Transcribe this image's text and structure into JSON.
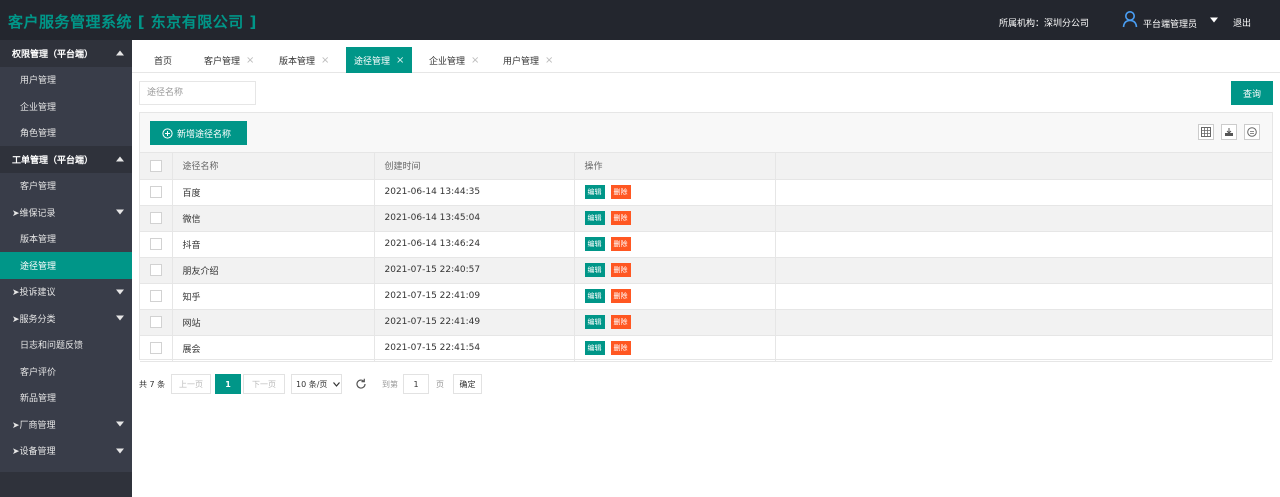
{
  "header": {
    "title": "客户服务管理系统 [ 东京有限公司 ]",
    "org_label": "所属机构：深圳分公司",
    "user_name": "平台端管理员",
    "logout": "退出"
  },
  "sidebar": {
    "items": [
      {
        "label": "权限管理（平台端）",
        "kind": "group",
        "arrow": "up"
      },
      {
        "label": "用户管理",
        "kind": "sub"
      },
      {
        "label": "企业管理",
        "kind": "sub"
      },
      {
        "label": "角色管理",
        "kind": "sub"
      },
      {
        "label": "工单管理（平台端）",
        "kind": "group",
        "arrow": "up"
      },
      {
        "label": "客户管理",
        "kind": "sub"
      },
      {
        "label": "➤维保记录",
        "kind": "tri",
        "arrow": "down"
      },
      {
        "label": "版本管理",
        "kind": "sub"
      },
      {
        "label": "途径管理",
        "kind": "sub",
        "active": true
      },
      {
        "label": "➤投诉建议",
        "kind": "tri",
        "arrow": "down"
      },
      {
        "label": "➤服务分类",
        "kind": "tri",
        "arrow": "down"
      },
      {
        "label": "日志和问题反馈",
        "kind": "sub"
      },
      {
        "label": "客户评价",
        "kind": "sub"
      },
      {
        "label": "新品管理",
        "kind": "sub"
      },
      {
        "label": "➤厂商管理",
        "kind": "tri",
        "arrow": "down"
      },
      {
        "label": "➤设备管理",
        "kind": "tri",
        "arrow": "down"
      }
    ]
  },
  "tabs": [
    {
      "label": "首页",
      "closable": false
    },
    {
      "label": "客户管理",
      "closable": true
    },
    {
      "label": "版本管理",
      "closable": true
    },
    {
      "label": "途径管理",
      "closable": true,
      "active": true
    },
    {
      "label": "企业管理",
      "closable": true
    },
    {
      "label": "用户管理",
      "closable": true
    }
  ],
  "tab_close_glyph": "×",
  "search": {
    "placeholder": "途径名称",
    "value": "",
    "button": "查询"
  },
  "toolbar": {
    "add_label": "新增途径名称"
  },
  "table": {
    "columns": [
      "途径名称",
      "创建时间",
      "操作"
    ],
    "rows": [
      {
        "name": "百度",
        "created": "2021-06-14 13:44:35"
      },
      {
        "name": "微信",
        "created": "2021-06-14 13:45:04"
      },
      {
        "name": "抖音",
        "created": "2021-06-14 13:46:24"
      },
      {
        "name": "朋友介绍",
        "created": "2021-07-15 22:40:57"
      },
      {
        "name": "知乎",
        "created": "2021-07-15 22:41:09"
      },
      {
        "name": "网站",
        "created": "2021-07-15 22:41:49"
      },
      {
        "name": "展会",
        "created": "2021-07-15 22:41:54"
      }
    ],
    "edit_label": "编辑",
    "delete_label": "删除"
  },
  "pagination": {
    "total": "共 7 条",
    "prev": "上一页",
    "current": "1",
    "next": "下一页",
    "page_size": "10 条/页",
    "goto_label": "到第",
    "goto_value": "1",
    "page_unit": "页",
    "confirm": "确定"
  },
  "colors": {
    "accent": "#009688",
    "danger": "#ff5722",
    "header_bg": "#23262e",
    "sidebar_bg": "#393d49"
  }
}
